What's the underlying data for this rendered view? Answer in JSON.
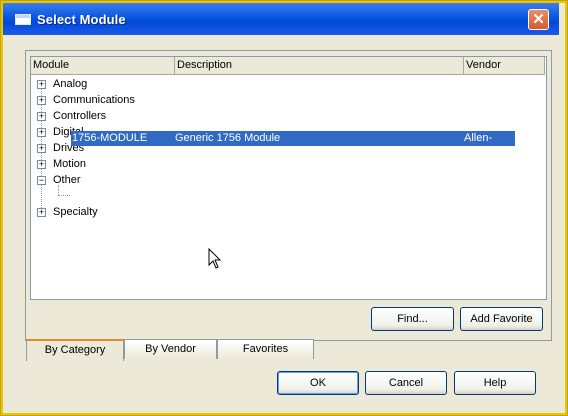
{
  "window": {
    "title": "Select Module",
    "close_glyph": "✕"
  },
  "list": {
    "columns": [
      "Module",
      "Description",
      "Vendor"
    ],
    "categories": [
      {
        "label": "Analog",
        "expander": "+"
      },
      {
        "label": "Communications",
        "expander": "+"
      },
      {
        "label": "Controllers",
        "expander": "+"
      },
      {
        "label": "Digital",
        "expander": "+"
      },
      {
        "label": "Drives",
        "expander": "+"
      },
      {
        "label": "Motion",
        "expander": "+"
      },
      {
        "label": "Other",
        "expander": "−"
      },
      {
        "label": "Specialty",
        "expander": "+"
      }
    ],
    "selected_item": {
      "module": "1756-MODULE",
      "description": "Generic 1756 Module",
      "vendor": "Allen-Bradley"
    }
  },
  "buttons": {
    "find": "Find...",
    "add_favorite": "Add Favorite",
    "ok": "OK",
    "cancel": "Cancel",
    "help": "Help"
  },
  "tabs": [
    "By Category",
    "By Vendor",
    "Favorites"
  ],
  "colors": {
    "titlebar": "#0a56e0",
    "selection": "#316ac5",
    "frame": "#e8c800",
    "dialog_bg": "#ece9d8"
  },
  "icons": {
    "close": "close-icon",
    "window": "window-icon",
    "cursor": "arrow-cursor-icon"
  }
}
